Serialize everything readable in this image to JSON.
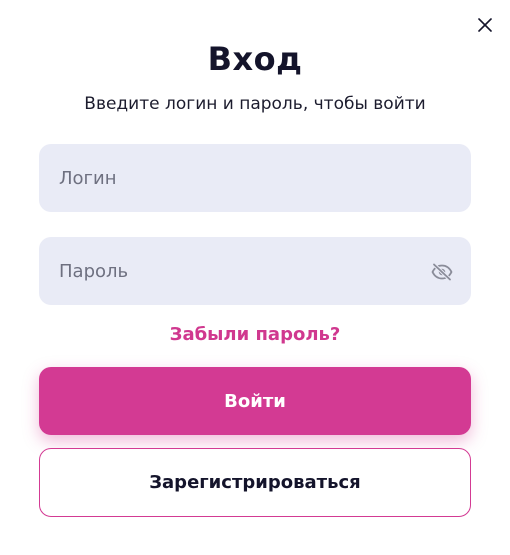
{
  "modal": {
    "title": "Вход",
    "subtitle": "Введите логин и пароль, чтобы войти",
    "close_icon": "close-icon"
  },
  "form": {
    "login": {
      "value": "",
      "placeholder": "Логин"
    },
    "password": {
      "value": "",
      "placeholder": "Пароль",
      "toggle_icon": "eye-off-icon"
    },
    "forgot_link": "Забыли пароль?",
    "submit_label": "Войти",
    "register_label": "Зарегистрироваться"
  },
  "colors": {
    "accent": "#d33a93",
    "field_bg": "#e9ebf6",
    "text_dark": "#14142b"
  }
}
